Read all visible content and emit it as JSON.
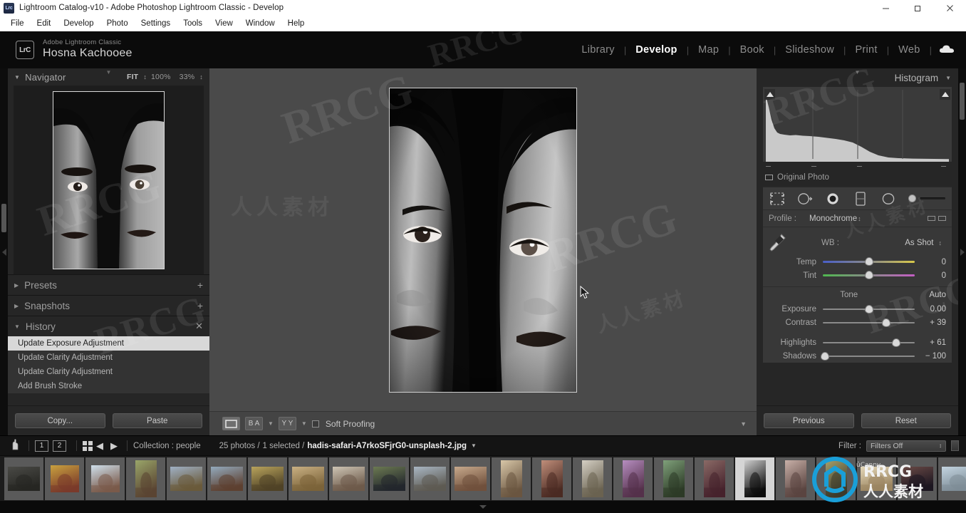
{
  "window": {
    "title": "Lightroom Catalog-v10 - Adobe Photoshop Lightroom Classic - Develop",
    "app_icon": "Lrc",
    "minimize": "—",
    "maximize": "❐",
    "close": "✕"
  },
  "menubar": {
    "items": [
      "File",
      "Edit",
      "Develop",
      "Photo",
      "Settings",
      "Tools",
      "View",
      "Window",
      "Help"
    ]
  },
  "identity": {
    "badge": "LrC",
    "app_name": "Adobe Lightroom Classic",
    "user_name": "Hosna Kachooee"
  },
  "modules": {
    "items": [
      {
        "label": "Library",
        "active": false
      },
      {
        "label": "Develop",
        "active": true
      },
      {
        "label": "Map",
        "active": false
      },
      {
        "label": "Book",
        "active": false
      },
      {
        "label": "Slideshow",
        "active": false
      },
      {
        "label": "Print",
        "active": false
      },
      {
        "label": "Web",
        "active": false
      }
    ],
    "separator": "|",
    "cloud_icon": "cloud-icon"
  },
  "navigator": {
    "title": "Navigator",
    "caret": "▼",
    "fit": "FIT",
    "zoom_100": "100%",
    "zoom_custom": "33%",
    "spinner": "↕"
  },
  "left_sections": [
    {
      "title": "Presets",
      "caret": "▶",
      "action": "+",
      "expanded": false
    },
    {
      "title": "Snapshots",
      "caret": "▶",
      "action": "+",
      "expanded": false
    },
    {
      "title": "History",
      "caret": "▼",
      "action": "✕",
      "expanded": true
    }
  ],
  "history": {
    "title": "History",
    "items": [
      {
        "label": "Update Exposure Adjustment",
        "selected": true
      },
      {
        "label": "Update Clarity Adjustment",
        "selected": false
      },
      {
        "label": "Update Clarity Adjustment",
        "selected": false
      },
      {
        "label": "Add Brush Stroke",
        "selected": false
      }
    ]
  },
  "left_footer": {
    "copy_label": "Copy...",
    "paste_label": "Paste"
  },
  "toolbar": {
    "loupe_icon": "loupe-view-icon",
    "compare_icon": "before-after-compare-icon",
    "yy_icon": "before-after-yy-icon",
    "yy_label": "Y Y",
    "ba_label": "B A",
    "caret": "▼",
    "soft_proofing_label": "Soft Proofing",
    "right_caret": "▼"
  },
  "histogram": {
    "title": "Histogram",
    "caret": "▼",
    "original_photo_label": "Original Photo",
    "shadow_clip_icon": "shadow-clipping-triangle",
    "highlight_clip_icon": "highlight-clipping-triangle"
  },
  "tool_strip": {
    "crop_icon": "crop-overlay-icon",
    "spot_removal_icon": "spot-removal-icon",
    "red_eye_icon": "red-eye-correction-icon",
    "graduated_filter_icon": "graduated-filter-icon",
    "radial_filter_icon": "radial-filter-icon",
    "brush_icon": "adjustment-brush-icon"
  },
  "basic_panel": {
    "profile_label": "Profile :",
    "profile_value": "Monochrome",
    "profile_spinner": "↕",
    "profile_browser_icon": "profile-browser-icon",
    "wb_label": "WB :",
    "wb_value": "As Shot",
    "wb_spinner": "↕",
    "eyedropper_icon": "white-balance-eyedropper-icon",
    "sliders": [
      {
        "name": "Temp",
        "value": "0",
        "pos": 50
      },
      {
        "name": "Tint",
        "value": "0",
        "pos": 50
      }
    ],
    "tone_label": "Tone",
    "auto_label": "Auto",
    "tone_sliders": [
      {
        "name": "Exposure",
        "value": "0.00",
        "pos": 50
      },
      {
        "name": "Contrast",
        "value": "+ 39",
        "pos": 69
      },
      {
        "name": "Highlights",
        "value": "+ 61",
        "pos": 80
      },
      {
        "name": "Shadows",
        "value": "− 100",
        "pos": 2
      }
    ]
  },
  "right_footer": {
    "previous_label": "Previous",
    "reset_label": "Reset"
  },
  "filmstrip_bar": {
    "grid_icon": "grid-view-icon",
    "back_arrow": "◀",
    "forward_arrow": "▶",
    "monitor1": "1",
    "monitor2": "2",
    "collection_label": "Collection : people",
    "photo_count": "25 photos /",
    "selected_count": "1 selected /",
    "filename": "hadis-safari-A7rkoSFjrG0-unsplash-2.jpg",
    "filename_caret": "▼",
    "filter_label": "Filter :",
    "filter_value": "Filters Off",
    "filter_spinner": "↕"
  },
  "filmstrip": {
    "thumbs": [
      {
        "id": 1,
        "kind": "landscape",
        "c1": "#4a4a46",
        "c2": "#262622",
        "selected": false
      },
      {
        "id": 2,
        "kind": "portrait",
        "c1": "#c9a13f",
        "c2": "#7a3a2a",
        "selected": false
      },
      {
        "id": 3,
        "kind": "portrait",
        "c1": "#cfe0ec",
        "c2": "#7a5a4a",
        "selected": false
      },
      {
        "id": 4,
        "kind": "tall",
        "c1": "#9aa66a",
        "c2": "#5a4432",
        "selected": false
      },
      {
        "id": 5,
        "kind": "landscape",
        "c1": "#9fb0c4",
        "c2": "#6a5a3a",
        "selected": false
      },
      {
        "id": 6,
        "kind": "landscape",
        "c1": "#93aabd",
        "c2": "#5d4030",
        "selected": false
      },
      {
        "id": 7,
        "kind": "landscape",
        "c1": "#b8a35c",
        "c2": "#4f4226",
        "selected": false
      },
      {
        "id": 8,
        "kind": "landscape",
        "c1": "#c9b083",
        "c2": "#7b6339",
        "selected": false
      },
      {
        "id": 9,
        "kind": "landscape",
        "c1": "#cdc4b4",
        "c2": "#6d5a4a",
        "selected": false
      },
      {
        "id": 10,
        "kind": "landscape",
        "c1": "#6c7a52",
        "c2": "#22262c",
        "selected": false
      },
      {
        "id": 11,
        "kind": "landscape",
        "c1": "#a9b6c3",
        "c2": "#5d5a52",
        "selected": false
      },
      {
        "id": 12,
        "kind": "landscape",
        "c1": "#c7a98c",
        "c2": "#70503c",
        "selected": false
      },
      {
        "id": 13,
        "kind": "tall",
        "c1": "#d8c7a8",
        "c2": "#6a5540",
        "selected": false
      },
      {
        "id": 14,
        "kind": "tall",
        "c1": "#c08e7a",
        "c2": "#4a2a22",
        "selected": false
      },
      {
        "id": 15,
        "kind": "tall",
        "c1": "#d4cfc4",
        "c2": "#6a6250",
        "selected": false
      },
      {
        "id": 16,
        "kind": "tall",
        "c1": "#b68ec0",
        "c2": "#54304a",
        "selected": false
      },
      {
        "id": 17,
        "kind": "tall",
        "c1": "#7fa07a",
        "c2": "#2c3a26",
        "selected": false
      },
      {
        "id": 18,
        "kind": "tall",
        "c1": "#8a6a66",
        "c2": "#46222c",
        "selected": false
      },
      {
        "id": 19,
        "kind": "tall",
        "c1": "#cfcfcf",
        "c2": "#0c0c0c",
        "selected": true
      },
      {
        "id": 20,
        "kind": "tall",
        "c1": "#c8b0a8",
        "c2": "#5a4440",
        "selected": false
      },
      {
        "id": 21,
        "kind": "tall",
        "c1": "#a7a06a",
        "c2": "#3c3a2a",
        "selected": false
      },
      {
        "id": 22,
        "kind": "landscape",
        "c1": "#e4d7b8",
        "c2": "#9a8460",
        "selected": false
      },
      {
        "id": 23,
        "kind": "landscape",
        "c1": "#6a4a46",
        "c2": "#1c1620",
        "selected": false
      },
      {
        "id": 24,
        "kind": "landscape",
        "c1": "#c3d4e0",
        "c2": "#7d8c96",
        "selected": false
      },
      {
        "id": 25,
        "kind": "landscape",
        "c1": "#8a7a6a",
        "c2": "#3a3028",
        "selected": false
      }
    ]
  },
  "watermarks": {
    "brand": "RRCG",
    "chinese": "人人素材",
    "ucanny": "ûCanny"
  },
  "colors": {
    "panel_bg": "#262626",
    "canvas_bg": "#4a4a4a",
    "accent_blue": "#1a9fd8",
    "selected_row": "#d8d8d8"
  }
}
